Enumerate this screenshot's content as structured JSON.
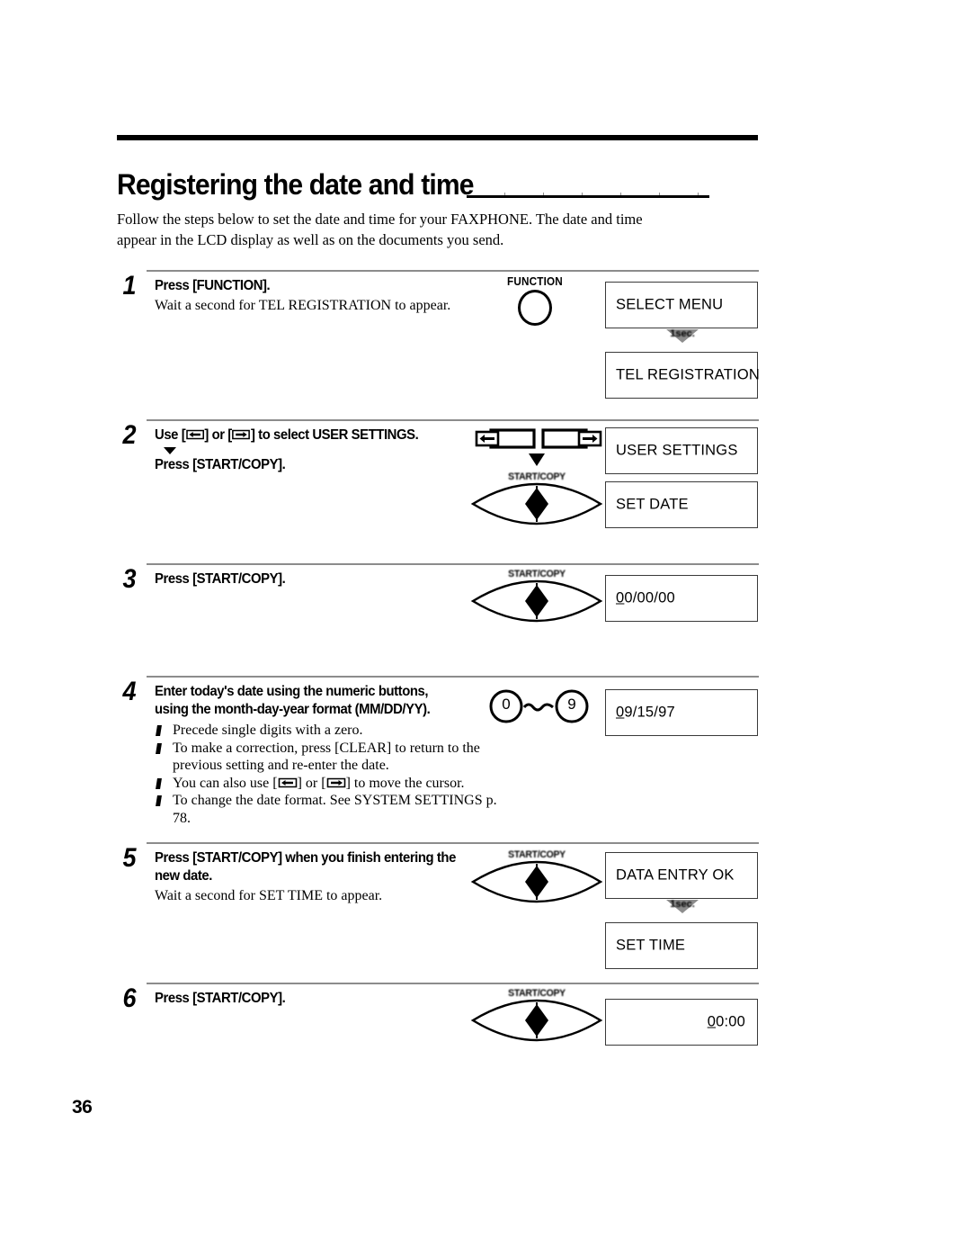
{
  "page": {
    "number": "36"
  },
  "header": {
    "title": "Registering the date and time",
    "intro": "Follow the steps below to set the date and time for your FAXPHONE. The date and time appear in the LCD display as well as on the documents you send."
  },
  "transition_label": "1sec.",
  "buttons": {
    "function_label": "FUNCTION",
    "startcopy_label": "START/COPY",
    "numeric_low": "0",
    "numeric_high": "9",
    "numeric_separator": "~"
  },
  "steps": [
    {
      "number": "1",
      "heading": "Press [FUNCTION].",
      "sub": "Wait a second for TEL REGISTRATION to appear.",
      "lcd": [
        {
          "text": "SELECT MENU",
          "align": "left"
        },
        {
          "text": "TEL REGISTRATION",
          "align": "left"
        }
      ]
    },
    {
      "number": "2",
      "heading_prefix": "Use [",
      "heading_mid": "] or [",
      "heading_suffix": "] to select USER SETTINGS.",
      "heading2": "Press [START/COPY].",
      "lcd": [
        {
          "text": "USER SETTINGS",
          "align": "left"
        },
        {
          "text": "SET DATE",
          "align": "left"
        }
      ]
    },
    {
      "number": "3",
      "heading": "Press [START/COPY].",
      "lcd": [
        {
          "cursor": "0",
          "rest": "0/00/00",
          "align": "left"
        }
      ]
    },
    {
      "number": "4",
      "heading_line1": "Enter today's date using the numeric buttons,",
      "heading_line2": "using the month-day-year format (MM/DD/YY).",
      "bullets": [
        "Precede single digits with a zero.",
        "To make a correction, press [CLEAR] to return to the previous setting and re-enter the date.",
        "You can also use [⇦] or [⇨] to move the cursor.",
        "To change the date format. See SYSTEM SETTINGS p. 78."
      ],
      "bullet3_prefix": "You can also use [",
      "bullet3_mid": "] or [",
      "bullet3_suffix": "] to move the cursor.",
      "lcd": [
        {
          "cursor": "0",
          "rest": "9/15/97",
          "align": "left"
        }
      ]
    },
    {
      "number": "5",
      "heading_line1": "Press [START/COPY] when you finish entering the",
      "heading_line2": "new date.",
      "sub": "Wait a second for SET TIME to appear.",
      "lcd": [
        {
          "text": "DATA ENTRY OK",
          "align": "left"
        },
        {
          "text": "SET TIME",
          "align": "left"
        }
      ]
    },
    {
      "number": "6",
      "heading": "Press [START/COPY].",
      "lcd": [
        {
          "cursor": "0",
          "rest": "0:00",
          "align": "right"
        }
      ]
    }
  ]
}
